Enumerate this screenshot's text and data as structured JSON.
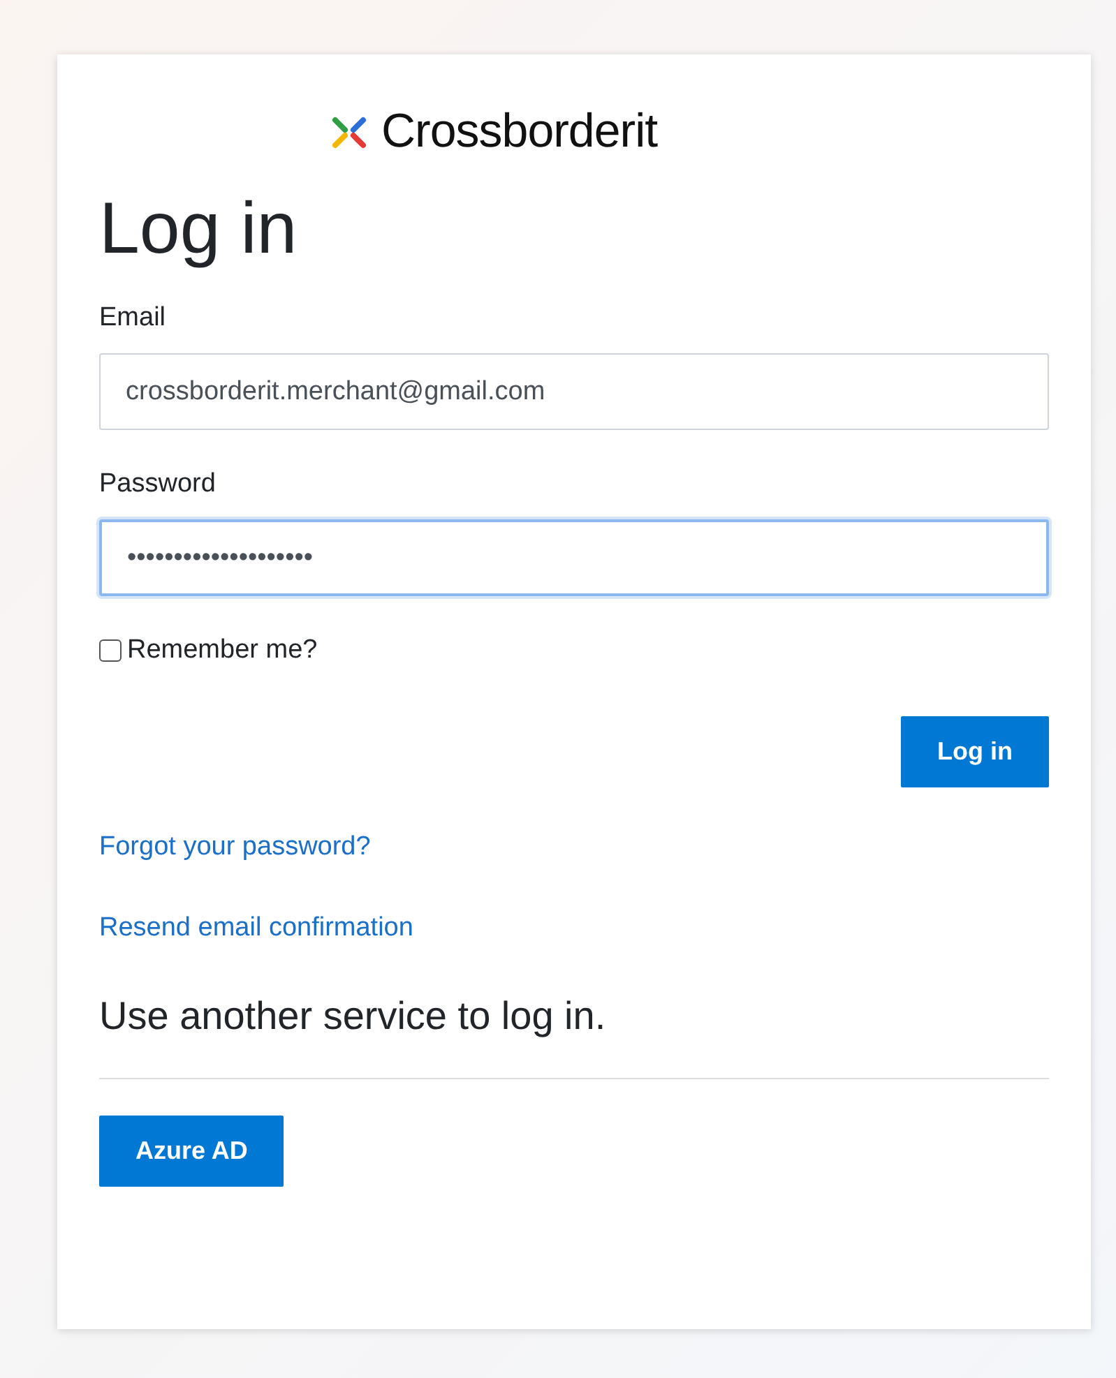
{
  "logo": {
    "text": "Crossborderit"
  },
  "heading": "Log in",
  "email": {
    "label": "Email",
    "value": "crossborderit.merchant@gmail.com",
    "focused": false
  },
  "password": {
    "label": "Password",
    "value": "••••••••••••••••••••",
    "focused": true
  },
  "remember": {
    "label": "Remember me?",
    "checked": false
  },
  "login_button": "Log in",
  "links": [
    "Forgot your password?",
    "Resend email confirmation"
  ],
  "external": {
    "heading": "Use another service to log in.",
    "buttons": [
      "Azure AD"
    ]
  }
}
